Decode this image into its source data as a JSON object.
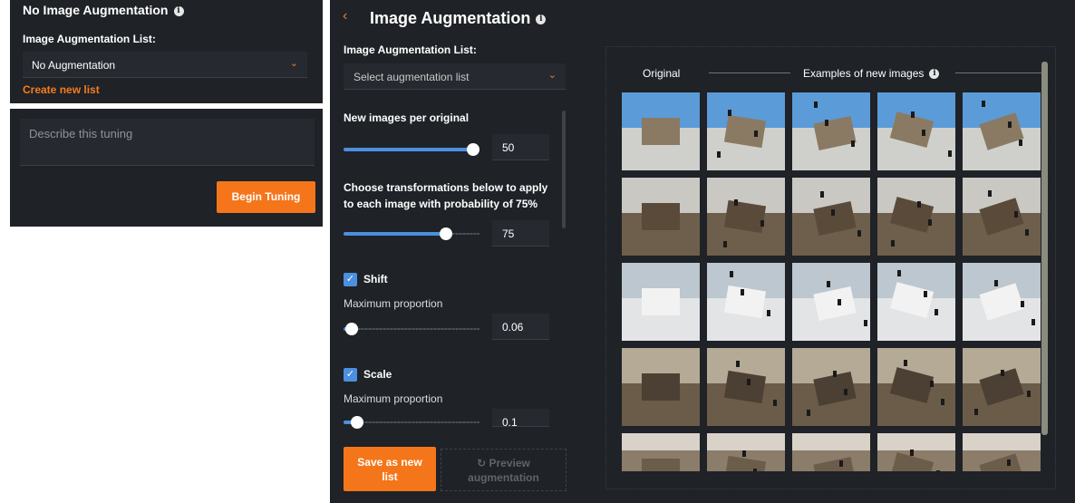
{
  "left_panel": {
    "title": "No Image Augmentation",
    "list_label": "Image Augmentation List:",
    "list_value": "No Augmentation",
    "create_link": "Create new list"
  },
  "tuning_panel": {
    "description_placeholder": "Describe this tuning",
    "begin_button": "Begin Tuning"
  },
  "main": {
    "back_icon": "chevron-left-icon",
    "title": "Image Augmentation",
    "list_label": "Image Augmentation List:",
    "list_placeholder": "Select augmentation list",
    "new_images_label": "New images per original",
    "new_images_value": "50",
    "new_images_fraction": 0.95,
    "transform_label_line1": "Choose transformations below to apply",
    "transform_label_line2": "to each image with probability of 75%",
    "probability_value": "75",
    "probability_fraction": 0.75,
    "shift": {
      "label": "Shift",
      "checked": true,
      "max_label": "Maximum proportion",
      "value": "0.06",
      "fraction": 0.06
    },
    "scale": {
      "label": "Scale",
      "checked": true,
      "max_label": "Maximum proportion",
      "value": "0.1",
      "fraction": 0.1
    },
    "save_button_line1": "Save as new",
    "save_button_line2": "list",
    "preview_button_line1": "↻ Preview",
    "preview_button_line2": "augmentation"
  },
  "gallery": {
    "original_header": "Original",
    "examples_header": "Examples of new images"
  },
  "colors": {
    "accent": "#f5761a",
    "slider": "#4c8fe0",
    "panel": "#1f2227"
  }
}
